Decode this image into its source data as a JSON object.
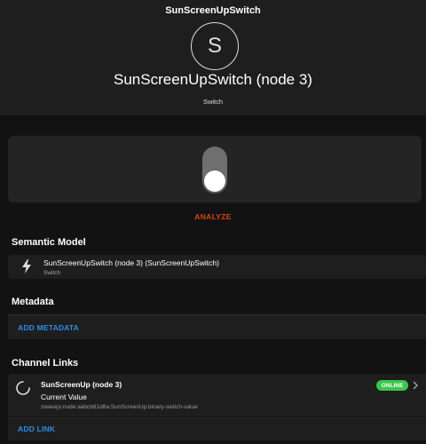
{
  "header": {
    "toolbar_title": "SunScreenUpSwitch",
    "avatar_letter": "S",
    "item_title": "SunScreenUpSwitch (node 3)",
    "item_type": "Switch"
  },
  "control": {
    "state": "OFF",
    "analyze_label": "ANALYZE"
  },
  "semantic_model": {
    "heading": "Semantic Model",
    "item_title": "SunScreenUpSwitch (node 3) (SunScreenUpSwitch)",
    "item_type": "Switch",
    "icon": "bolt-icon"
  },
  "metadata": {
    "heading": "Metadata",
    "add_label": "ADD METADATA"
  },
  "channel_links": {
    "heading": "Channel Links",
    "link": {
      "title": "SunScreenUp (node 3)",
      "channel_label": "Current Value",
      "uid": "zwavejs:node:aabcb81d8a:SunScreenUp:binary-switch-value",
      "status": "ONLINE",
      "icon": "spinner-icon"
    },
    "add_label": "ADD LINK"
  },
  "colors": {
    "accent": "#2b8fe6",
    "analyze": "#d84315",
    "online": "#3cc54c",
    "background": "#121212",
    "surface": "#1e1e1e"
  }
}
